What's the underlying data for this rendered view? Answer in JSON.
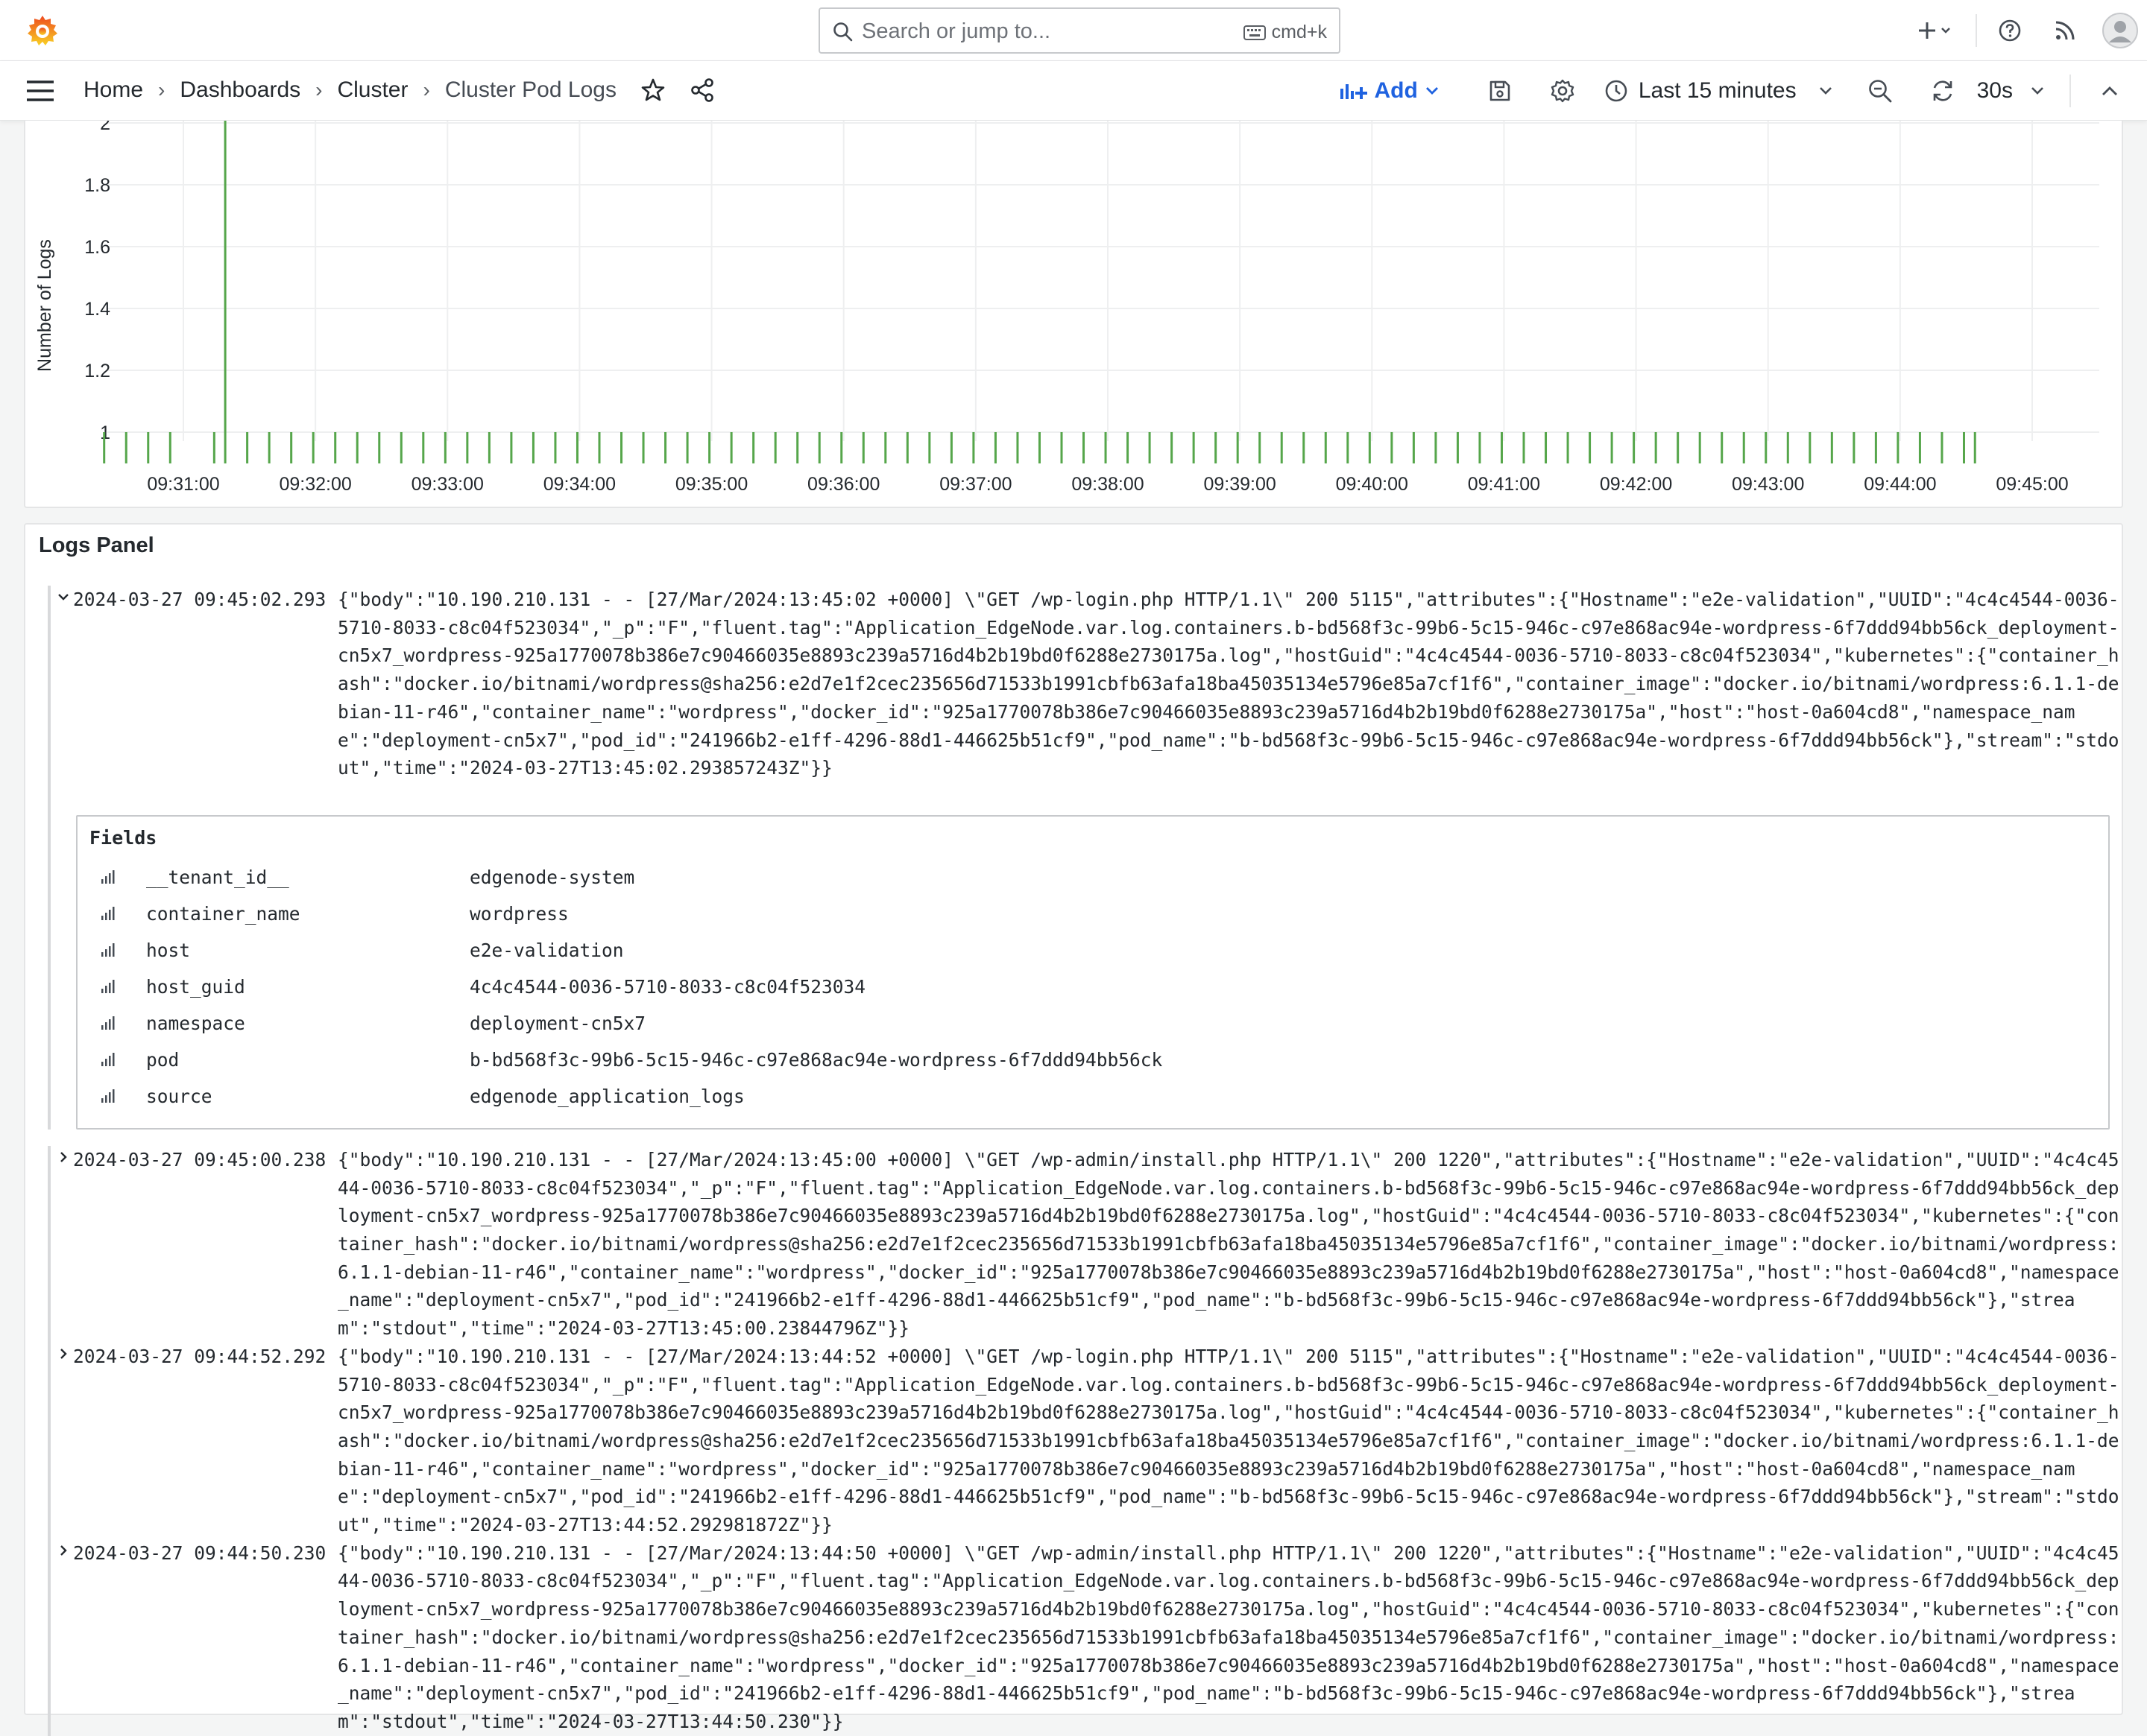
{
  "topbar": {
    "search_placeholder": "Search or jump to...",
    "shortcut": "cmd+k"
  },
  "nav": {
    "breadcrumbs": [
      "Home",
      "Dashboards",
      "Cluster",
      "Cluster Pod Logs"
    ],
    "add_label": "Add",
    "time_range": "Last 15 minutes",
    "refresh_interval": "30s"
  },
  "chart_data": {
    "type": "bar",
    "ylabel": "Number of Logs",
    "xlabel": "",
    "ylim": [
      1,
      2
    ],
    "yticks": [
      "1",
      "1.2",
      "1.4",
      "1.6",
      "1.8",
      "2"
    ],
    "xticks": [
      "09:31:00",
      "09:32:00",
      "09:33:00",
      "09:34:00",
      "09:35:00",
      "09:36:00",
      "09:37:00",
      "09:38:00",
      "09:39:00",
      "09:40:00",
      "09:41:00",
      "09:42:00",
      "09:43:00",
      "09:44:00",
      "09:45:00"
    ],
    "x_start": "09:30:24",
    "interval_seconds": 5,
    "values": [
      1,
      0,
      1,
      0,
      1,
      0,
      1,
      0,
      0,
      0,
      1,
      2,
      0,
      1,
      0,
      1,
      0,
      1,
      0,
      1,
      0,
      1,
      0,
      1,
      0,
      1,
      0,
      1,
      0,
      1,
      0,
      1,
      0,
      1,
      0,
      1,
      0,
      1,
      0,
      1,
      0,
      1,
      0,
      1,
      0,
      1,
      0,
      1,
      0,
      1,
      0,
      1,
      0,
      1,
      0,
      1,
      0,
      1,
      0,
      1,
      0,
      1,
      0,
      1,
      0,
      1,
      0,
      1,
      0,
      1,
      0,
      1,
      0,
      1,
      0,
      1,
      0,
      1,
      0,
      1,
      0,
      1,
      0,
      1,
      0,
      1,
      0,
      1,
      0,
      1,
      0,
      1,
      0,
      1,
      0,
      1,
      0,
      1,
      0,
      1,
      0,
      1,
      0,
      1,
      0,
      1,
      0,
      1,
      0,
      1,
      0,
      1,
      0,
      1,
      0,
      1,
      0,
      1,
      0,
      1,
      0,
      1,
      0,
      1,
      0,
      1,
      0,
      1,
      0,
      1,
      0,
      1,
      0,
      1,
      0,
      1,
      0,
      1,
      0,
      1,
      0,
      1,
      0,
      1,
      0,
      1,
      0,
      1,
      0,
      1,
      0,
      1,
      0,
      1,
      0,
      1,
      0,
      1,
      0,
      1,
      0,
      1,
      0,
      1,
      0,
      1,
      0,
      1,
      0,
      1,
      1
    ],
    "color": "#56a64b",
    "grid": true
  },
  "logs_panel": {
    "title": "Logs Panel",
    "fields_title": "Fields",
    "fields": [
      {
        "key": "__tenant_id__",
        "value": "edgenode-system"
      },
      {
        "key": "container_name",
        "value": "wordpress"
      },
      {
        "key": "host",
        "value": "e2e-validation"
      },
      {
        "key": "host_guid",
        "value": "4c4c4544-0036-5710-8033-c8c04f523034"
      },
      {
        "key": "namespace",
        "value": "deployment-cn5x7"
      },
      {
        "key": "pod",
        "value": "b-bd568f3c-99b6-5c15-946c-c97e868ac94e-wordpress-6f7ddd94bb56ck"
      },
      {
        "key": "source",
        "value": "edgenode_application_logs"
      }
    ],
    "entries": [
      {
        "timestamp": "2024-03-27 09:45:02.293",
        "message": "{\"body\":\"10.190.210.131 - - [27/Mar/2024:13:45:02 +0000] \\\"GET /wp-login.php HTTP/1.1\\\" 200 5115\",\"attributes\":{\"Hostname\":\"e2e-validation\",\"UUID\":\"4c4c4544-0036-5710-8033-c8c04f523034\",\"_p\":\"F\",\"fluent.tag\":\"Application_EdgeNode.var.log.containers.b-bd568f3c-99b6-5c15-946c-c97e868ac94e-wordpress-6f7ddd94bb56ck_deployment-cn5x7_wordpress-925a1770078b386e7c90466035e8893c239a5716d4b2b19bd0f6288e2730175a.log\",\"hostGuid\":\"4c4c4544-0036-5710-8033-c8c04f523034\",\"kubernetes\":{\"container_hash\":\"docker.io/bitnami/wordpress@sha256:e2d7e1f2cec235656d71533b1991cbfb63afa18ba45035134e5796e85a7cf1f6\",\"container_image\":\"docker.io/bitnami/wordpress:6.1.1-debian-11-r46\",\"container_name\":\"wordpress\",\"docker_id\":\"925a1770078b386e7c90466035e8893c239a5716d4b2b19bd0f6288e2730175a\",\"host\":\"host-0a604cd8\",\"namespace_name\":\"deployment-cn5x7\",\"pod_id\":\"241966b2-e1ff-4296-88d1-446625b51cf9\",\"pod_name\":\"b-bd568f3c-99b6-5c15-946c-c97e868ac94e-wordpress-6f7ddd94bb56ck\"},\"stream\":\"stdout\",\"time\":\"2024-03-27T13:45:02.293857243Z\"}}"
      },
      {
        "timestamp": "2024-03-27 09:45:00.238",
        "message": "{\"body\":\"10.190.210.131 - - [27/Mar/2024:13:45:00 +0000] \\\"GET /wp-admin/install.php HTTP/1.1\\\" 200 1220\",\"attributes\":{\"Hostname\":\"e2e-validation\",\"UUID\":\"4c4c4544-0036-5710-8033-c8c04f523034\",\"_p\":\"F\",\"fluent.tag\":\"Application_EdgeNode.var.log.containers.b-bd568f3c-99b6-5c15-946c-c97e868ac94e-wordpress-6f7ddd94bb56ck_deployment-cn5x7_wordpress-925a1770078b386e7c90466035e8893c239a5716d4b2b19bd0f6288e2730175a.log\",\"hostGuid\":\"4c4c4544-0036-5710-8033-c8c04f523034\",\"kubernetes\":{\"container_hash\":\"docker.io/bitnami/wordpress@sha256:e2d7e1f2cec235656d71533b1991cbfb63afa18ba45035134e5796e85a7cf1f6\",\"container_image\":\"docker.io/bitnami/wordpress:6.1.1-debian-11-r46\",\"container_name\":\"wordpress\",\"docker_id\":\"925a1770078b386e7c90466035e8893c239a5716d4b2b19bd0f6288e2730175a\",\"host\":\"host-0a604cd8\",\"namespace_name\":\"deployment-cn5x7\",\"pod_id\":\"241966b2-e1ff-4296-88d1-446625b51cf9\",\"pod_name\":\"b-bd568f3c-99b6-5c15-946c-c97e868ac94e-wordpress-6f7ddd94bb56ck\"},\"stream\":\"stdout\",\"time\":\"2024-03-27T13:45:00.23844796Z\"}}"
      },
      {
        "timestamp": "2024-03-27 09:44:52.292",
        "message": "{\"body\":\"10.190.210.131 - - [27/Mar/2024:13:44:52 +0000] \\\"GET /wp-login.php HTTP/1.1\\\" 200 5115\",\"attributes\":{\"Hostname\":\"e2e-validation\",\"UUID\":\"4c4c4544-0036-5710-8033-c8c04f523034\",\"_p\":\"F\",\"fluent.tag\":\"Application_EdgeNode.var.log.containers.b-bd568f3c-99b6-5c15-946c-c97e868ac94e-wordpress-6f7ddd94bb56ck_deployment-cn5x7_wordpress-925a1770078b386e7c90466035e8893c239a5716d4b2b19bd0f6288e2730175a.log\",\"hostGuid\":\"4c4c4544-0036-5710-8033-c8c04f523034\",\"kubernetes\":{\"container_hash\":\"docker.io/bitnami/wordpress@sha256:e2d7e1f2cec235656d71533b1991cbfb63afa18ba45035134e5796e85a7cf1f6\",\"container_image\":\"docker.io/bitnami/wordpress:6.1.1-debian-11-r46\",\"container_name\":\"wordpress\",\"docker_id\":\"925a1770078b386e7c90466035e8893c239a5716d4b2b19bd0f6288e2730175a\",\"host\":\"host-0a604cd8\",\"namespace_name\":\"deployment-cn5x7\",\"pod_id\":\"241966b2-e1ff-4296-88d1-446625b51cf9\",\"pod_name\":\"b-bd568f3c-99b6-5c15-946c-c97e868ac94e-wordpress-6f7ddd94bb56ck\"},\"stream\":\"stdout\",\"time\":\"2024-03-27T13:44:52.292981872Z\"}}"
      },
      {
        "timestamp": "2024-03-27 09:44:50.230",
        "message": "{\"body\":\"10.190.210.131 - - [27/Mar/2024:13:44:50 +0000] \\\"GET /wp-admin/install.php HTTP/1.1\\\" 200 1220\",\"attributes\":{\"Hostname\":\"e2e-validation\",\"UUID\":\"4c4c4544-0036-5710-8033-c8c04f523034\",\"_p\":\"F\",\"fluent.tag\":\"Application_EdgeNode.var.log.containers.b-bd568f3c-99b6-5c15-946c-c97e868ac94e-wordpress-6f7ddd94bb56ck_deployment-cn5x7_wordpress-925a1770078b386e7c90466035e8893c239a5716d4b2b19bd0f6288e2730175a.log\",\"hostGuid\":\"4c4c4544-0036-5710-8033-c8c04f523034\",\"kubernetes\":{\"container_hash\":\"docker.io/bitnami/wordpress@sha256:e2d7e1f2cec235656d71533b1991cbfb63afa18ba45035134e5796e85a7cf1f6\",\"container_image\":\"docker.io/bitnami/wordpress:6.1.1-debian-11-r46\",\"container_name\":\"wordpress\",\"docker_id\":\"925a1770078b386e7c90466035e8893c239a5716d4b2b19bd0f6288e2730175a\",\"host\":\"host-0a604cd8\",\"namespace_name\":\"deployment-cn5x7\",\"pod_id\":\"241966b2-e1ff-4296-88d1-446625b51cf9\",\"pod_name\":\"b-bd568f3c-99b6-5c15-946c-c97e868ac94e-wordpress-6f7ddd94bb56ck\"},\"stream\":\"stdout\",\"time\":\"2024-03-27T13:44:50.230\"}}"
      }
    ]
  }
}
